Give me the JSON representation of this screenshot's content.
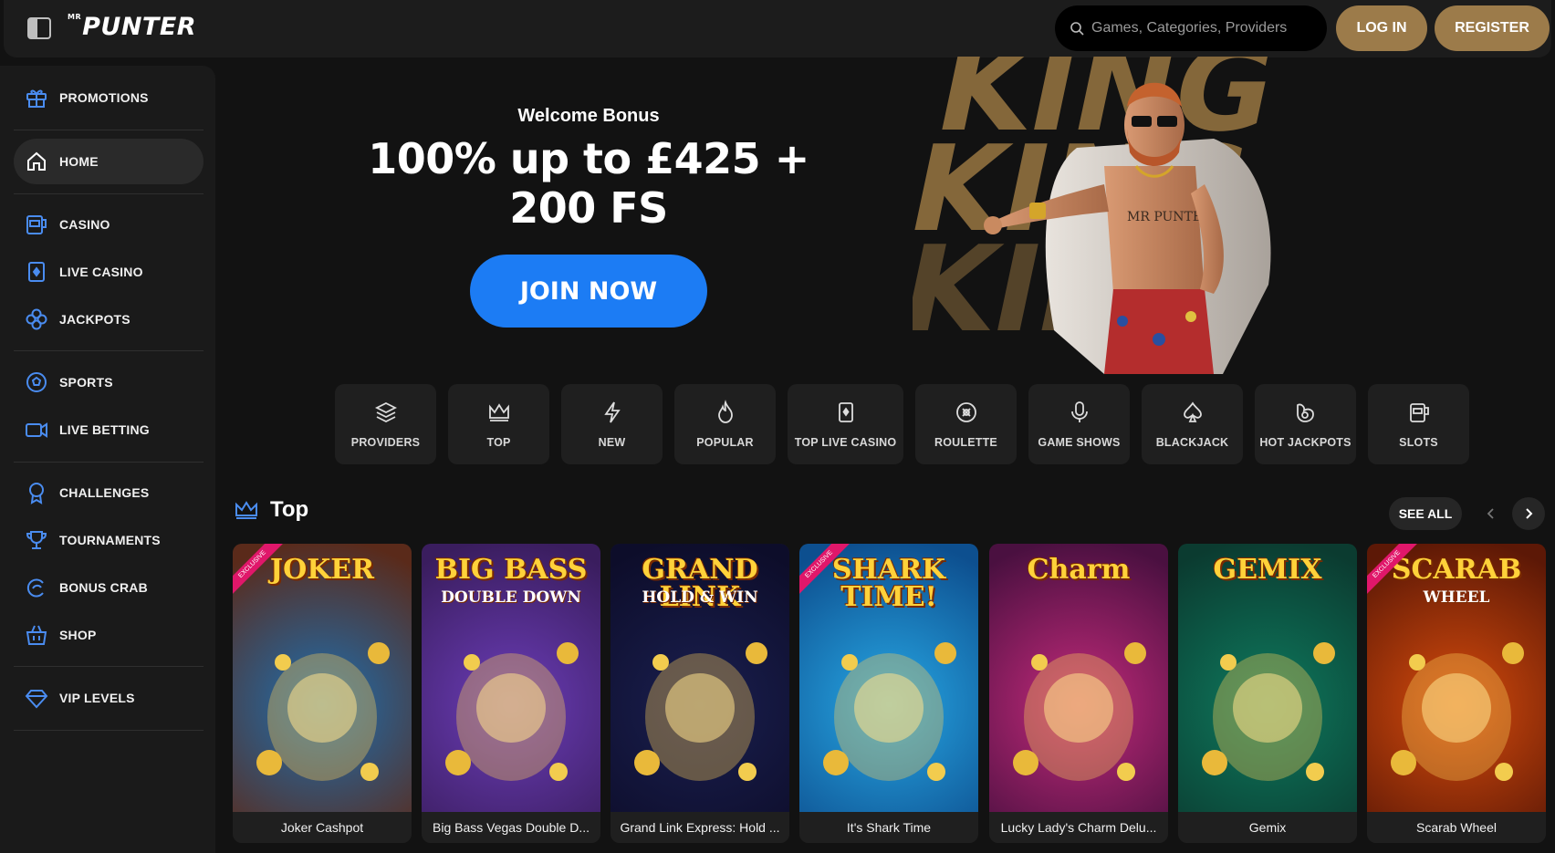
{
  "header": {
    "logo_small": "MR",
    "logo": "PUNTER",
    "search_placeholder": "Games, Categories, Providers",
    "login_label": "LOG IN",
    "register_label": "REGISTER"
  },
  "sidebar": {
    "items": [
      {
        "label": "PROMOTIONS",
        "icon": "gift-icon"
      },
      {
        "label": "HOME",
        "icon": "home-icon",
        "active": true
      },
      {
        "label": "CASINO",
        "icon": "slot-machine-icon"
      },
      {
        "label": "LIVE CASINO",
        "icon": "card-icon"
      },
      {
        "label": "JACKPOTS",
        "icon": "clover-icon"
      },
      {
        "label": "SPORTS",
        "icon": "soccer-ball-icon"
      },
      {
        "label": "LIVE BETTING",
        "icon": "video-camera-icon"
      },
      {
        "label": "CHALLENGES",
        "icon": "medal-icon"
      },
      {
        "label": "TOURNAMENTS",
        "icon": "trophy-icon"
      },
      {
        "label": "BONUS CRAB",
        "icon": "crab-icon"
      },
      {
        "label": "SHOP",
        "icon": "basket-icon"
      },
      {
        "label": "VIP LEVELS",
        "icon": "diamond-icon"
      }
    ]
  },
  "hero": {
    "subtitle": "Welcome Bonus",
    "title_line1": "100% up to £425 +",
    "title_line2": "200 FS",
    "cta": "JOIN NOW",
    "art_word": "KING",
    "figure_shirt_text": "MR PUNTER"
  },
  "categories": [
    {
      "label": "PROVIDERS",
      "icon": "layers-icon"
    },
    {
      "label": "TOP",
      "icon": "crown-icon"
    },
    {
      "label": "NEW",
      "icon": "lightning-icon"
    },
    {
      "label": "POPULAR",
      "icon": "flame-icon"
    },
    {
      "label": "TOP LIVE CASINO",
      "icon": "card-icon"
    },
    {
      "label": "ROULETTE",
      "icon": "roulette-icon"
    },
    {
      "label": "GAME SHOWS",
      "icon": "microphone-icon"
    },
    {
      "label": "BLACKJACK",
      "icon": "spade-icon"
    },
    {
      "label": "HOT JACKPOTS",
      "icon": "jackpot-icon"
    },
    {
      "label": "SLOTS",
      "icon": "slot-machine-icon"
    }
  ],
  "section": {
    "title": "Top",
    "see_all": "SEE ALL"
  },
  "games": [
    {
      "name": "Joker Cashpot",
      "art_title": "JOKER",
      "ribbon": "EXCLUSIVE",
      "bg": "#1e6fb0",
      "bg2": "#5a2a1a"
    },
    {
      "name": "Big Bass Vegas Double D...",
      "art_title": "BIG BASS",
      "art_sub": "DOUBLE DOWN",
      "bg": "#6b3db8",
      "bg2": "#3a1d5e"
    },
    {
      "name": "Grand Link Express: Hold ...",
      "art_title": "GRAND LINK",
      "art_sub": "HOLD & WIN",
      "bg": "#1a1f4f",
      "bg2": "#0d0d2a"
    },
    {
      "name": "It's Shark Time",
      "art_title": "SHARK TIME!",
      "ribbon": "EXCLUSIVE",
      "bg": "#27a7e4",
      "bg2": "#0d4f8f"
    },
    {
      "name": "Lucky Lady's Charm Delu...",
      "art_title": "Charm",
      "bg": "#c22a7a",
      "bg2": "#4a1040"
    },
    {
      "name": "Gemix",
      "art_title": "GEMIX",
      "bg": "#0e7a5e",
      "bg2": "#0b3b30"
    },
    {
      "name": "Scarab Wheel",
      "art_title": "SCARAB",
      "art_sub": "WHEEL",
      "ribbon": "EXCLUSIVE",
      "bg": "#d64b0c",
      "bg2": "#5c1806"
    }
  ]
}
